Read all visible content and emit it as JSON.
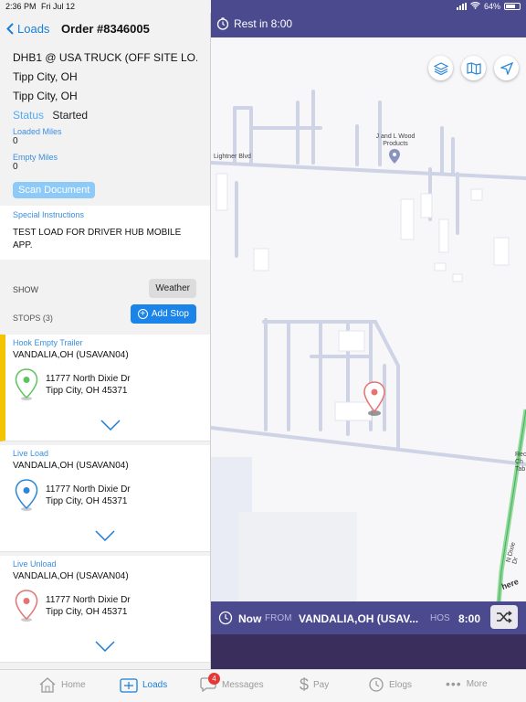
{
  "status_bar": {
    "time": "2:36 PM",
    "date": "Fri Jul 12",
    "battery": "64%",
    "battery_level": 0.64
  },
  "nav": {
    "back_label": "Loads",
    "title": "Order #8346005"
  },
  "order": {
    "name": "DHB1 @ USA TRUCK (OFF SITE LO...",
    "origin_city": "Tipp City, OH",
    "destination_city": "Tipp City, OH",
    "status_label": "Status",
    "status_value": "Started",
    "loaded_miles_label": "Loaded Miles",
    "loaded_miles": "0",
    "empty_miles_label": "Empty Miles",
    "empty_miles": "0",
    "scan_button": "Scan Document"
  },
  "instructions": {
    "label": "Special Instructions",
    "text": "TEST LOAD FOR DRIVER HUB MOBILE APP."
  },
  "show": {
    "label": "SHOW",
    "weather_button": "Weather"
  },
  "stops_header": {
    "label": "STOPS (3)",
    "add_button": "Add Stop"
  },
  "stops": [
    {
      "type": "Hook Empty Trailer",
      "location": "VANDALIA,OH (USAVAN04)",
      "address1": "11777 North  Dixie Dr",
      "address2": "Tipp City, OH 45371",
      "pin_color": "#5cc45a"
    },
    {
      "type": "Live Load",
      "location": "VANDALIA,OH (USAVAN04)",
      "address1": "11777 North  Dixie Dr",
      "address2": "Tipp City, OH 45371",
      "pin_color": "#2a86d8"
    },
    {
      "type": "Live Unload",
      "location": "VANDALIA,OH (USAVAN04)",
      "address1": "11777 North  Dixie Dr",
      "address2": "Tipp City, OH 45371",
      "pin_color": "#e57373"
    }
  ],
  "map": {
    "rest_label": "Rest in 8:00",
    "poi": "J and L Wood Products",
    "road_lightner": "Lightner Blvd",
    "road_dixie": "N Dixie Dr",
    "poi_right": "Rec Ch Tab",
    "watermark": "here",
    "buttons": [
      "layers-icon",
      "map-icon",
      "navigation-icon"
    ]
  },
  "trip_bar": {
    "now": "Now",
    "from": "FROM",
    "destination": "VANDALIA,OH (USAV...",
    "hos_label": "HOS",
    "hos_value": "8:00"
  },
  "tabs": [
    {
      "label": "Home",
      "icon": "home-icon"
    },
    {
      "label": "Loads",
      "icon": "loads-icon",
      "active": true
    },
    {
      "label": "Messages",
      "icon": "messages-icon",
      "badge": "4"
    },
    {
      "label": "Pay",
      "icon": "dollar-icon"
    },
    {
      "label": "Elogs",
      "icon": "elogs-icon"
    },
    {
      "label": "More",
      "icon": "more-icon"
    }
  ],
  "colors": {
    "accent": "#1a7ed8",
    "header_purple": "#4b4a8f",
    "active_stop": "#f5c400"
  }
}
